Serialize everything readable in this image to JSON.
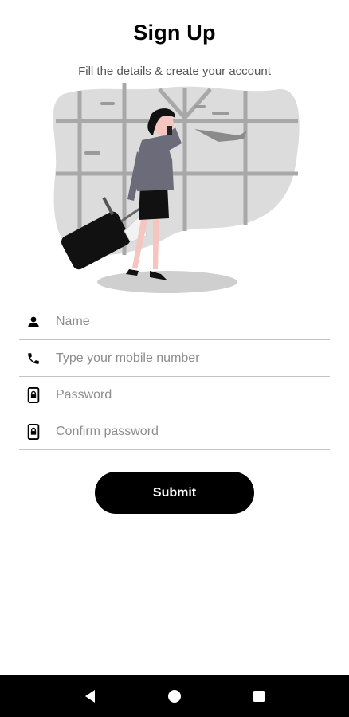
{
  "header": {
    "title": "Sign Up",
    "subtitle": "Fill the details & create your account"
  },
  "illustration": {
    "icon": "traveler-with-luggage-illustration"
  },
  "form": {
    "fields": [
      {
        "icon": "person-icon",
        "placeholder": "Name",
        "value": ""
      },
      {
        "icon": "phone-icon",
        "placeholder": "Type your mobile number",
        "value": ""
      },
      {
        "icon": "lock-phone-icon",
        "placeholder": "Password",
        "value": ""
      },
      {
        "icon": "lock-phone-icon",
        "placeholder": "Confirm password",
        "value": ""
      }
    ],
    "submit_label": "Submit"
  },
  "navbar": {
    "items": [
      "back-icon",
      "home-icon",
      "recents-icon"
    ]
  },
  "colors": {
    "accent": "#000000",
    "divider": "#c4c4c4",
    "placeholder": "#8d8d8d"
  }
}
